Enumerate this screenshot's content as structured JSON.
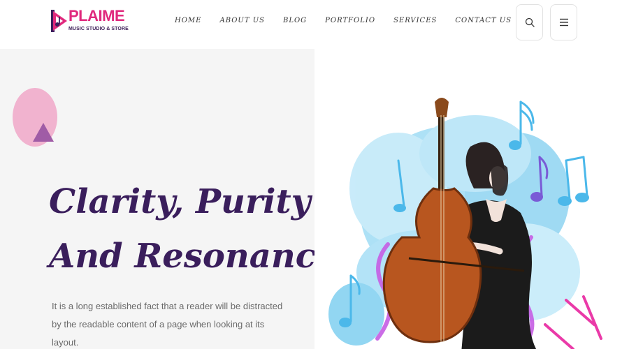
{
  "brand": {
    "name": "PLAIME",
    "tagline": "MUSIC STUDIO & STORE",
    "colors": {
      "primary": "#e0297d",
      "dark": "#3a1e5c",
      "accent": "#a05ca6"
    }
  },
  "nav": {
    "items": [
      {
        "label": "HOME"
      },
      {
        "label": "ABOUT US"
      },
      {
        "label": "BLOG"
      },
      {
        "label": "PORTFOLIO"
      },
      {
        "label": "SERVICES"
      },
      {
        "label": "CONTACT US"
      }
    ]
  },
  "header": {
    "search_icon": "search-icon",
    "menu_icon": "hamburger-menu-icon"
  },
  "hero": {
    "title_line1": "Clarity, Purity",
    "title_line2": "And Resonance.",
    "description": "It is a long established fact that a reader will be distracted by the readable content of a page when looking at its layout.",
    "image": "woman-playing-double-bass-with-music-notes"
  }
}
